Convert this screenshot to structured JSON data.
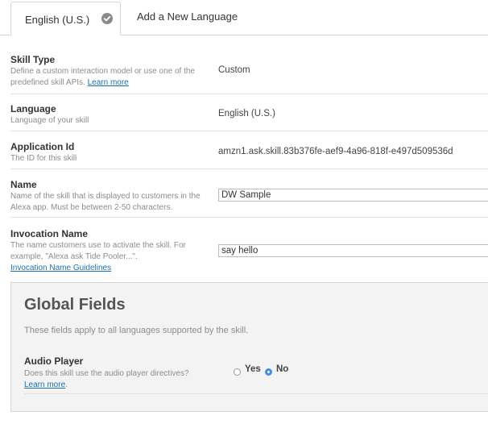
{
  "tabs": {
    "active_label": "English (U.S.)",
    "add_language_label": "Add a New Language"
  },
  "fields": {
    "skill_type": {
      "title": "Skill Type",
      "desc": "Define a custom interaction model or use one of the predefined skill APIs.",
      "link": "Learn more",
      "value": "Custom"
    },
    "language": {
      "title": "Language",
      "desc": "Language of your skill",
      "value": "English (U.S.)"
    },
    "application_id": {
      "title": "Application Id",
      "desc": "The ID for this skill",
      "value": "amzn1.ask.skill.83b376fe-aef9-4a96-818f-e497d509536d"
    },
    "name": {
      "title": "Name",
      "desc": "Name of the skill that is displayed to customers in the Alexa app. Must be between 2-50 characters.",
      "value": "DW Sample"
    },
    "invocation_name": {
      "title": "Invocation Name",
      "desc": "The name customers use to activate the skill. For example, \"Alexa ask Tide Pooler...\".",
      "link": "Invocation Name Guidelines",
      "value": "say hello"
    }
  },
  "global_fields": {
    "title": "Global Fields",
    "subtitle": "These fields apply to all languages supported by the skill.",
    "audio_player": {
      "title": "Audio Player",
      "desc": "Does this skill use the audio player directives?",
      "link": "Learn more",
      "link_suffix": ".",
      "options": [
        "Yes",
        "No"
      ],
      "selected": "No"
    }
  },
  "colors": {
    "link": "#1a6fb5",
    "radio_selected": "#3a8ee6"
  }
}
